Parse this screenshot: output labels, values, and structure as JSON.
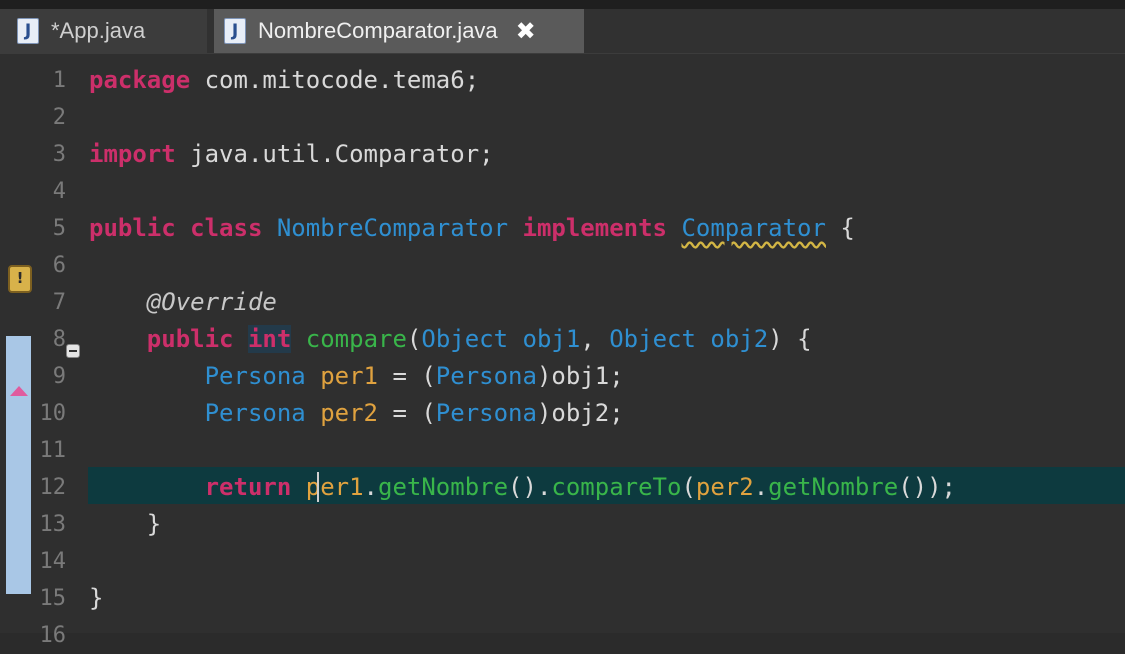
{
  "tabs": [
    {
      "icon": "java-file-icon",
      "icon_glyph": "J",
      "label": "*App.java",
      "active": false
    },
    {
      "icon": "java-file-icon",
      "icon_glyph": "J",
      "label": "NombreComparator.java",
      "active": true,
      "close_glyph": "✖"
    }
  ],
  "gutter": {
    "line_numbers": [
      "1",
      "2",
      "3",
      "4",
      "5",
      "6",
      "7",
      "8",
      "9",
      "10",
      "11",
      "12",
      "13",
      "14",
      "15",
      "16"
    ]
  },
  "code": {
    "l1": {
      "kw": "package",
      "rest": " com.mitocode.tema6;"
    },
    "l3": {
      "kw": "import",
      "rest": " java.util.Comparator;"
    },
    "l5": {
      "kw1": "public",
      "kw2": "class",
      "cls": "NombreComparator",
      "kw3": "implements",
      "iface": "Comparator",
      "brace": " {"
    },
    "l7": {
      "annotation": "@Override"
    },
    "l8": {
      "kw": "public",
      "type": "int",
      "method": "compare",
      "p_open": "(",
      "t1": "Object",
      "a1": "obj1",
      "comma": ", ",
      "t2": "Object",
      "a2": "obj2",
      "p_close": ") {"
    },
    "l9": {
      "type": "Persona",
      "var": "per1",
      "eq": " = (",
      "cast": "Persona",
      "rest": ")obj1;"
    },
    "l10": {
      "type": "Persona",
      "var": "per2",
      "eq": " = (",
      "cast": "Persona",
      "rest": ")obj2;"
    },
    "l12": {
      "kw": "return",
      "v1": "per1",
      "dot1": ".",
      "m1": "getNombre",
      "p1": "().",
      "m2": "compareTo",
      "p2": "(",
      "v2": "per2",
      "dot2": ".",
      "m3": "getNombre",
      "p3": "());"
    },
    "l13": {
      "brace": "}"
    },
    "l15": {
      "brace": "}"
    }
  },
  "colors": {
    "keyword": "#cc2f6a",
    "type": "#2f8fd1",
    "method": "#39b54a",
    "variable": "#e0a23f",
    "current_line": "#0d3a3f"
  }
}
